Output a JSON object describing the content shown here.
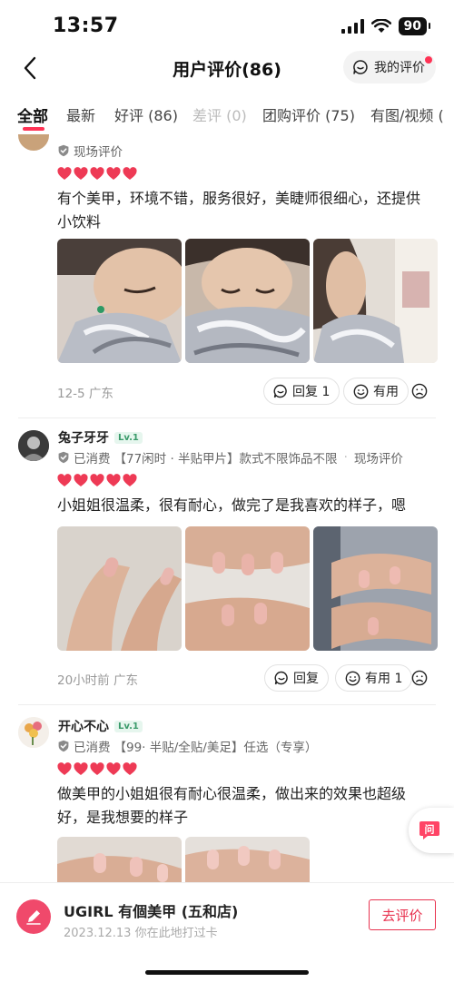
{
  "status": {
    "time": "13:57",
    "battery": "90"
  },
  "nav": {
    "title": "用户评价(86)",
    "my_review_label": "我的评价"
  },
  "tabs": [
    {
      "label": "全部"
    },
    {
      "label": "最新"
    },
    {
      "label": "好评 (86)"
    },
    {
      "label": "差评 (0)"
    },
    {
      "label": "团购评价 (75)"
    },
    {
      "label": "有图/视频 ("
    }
  ],
  "reviews": [
    {
      "meta": "现场评价",
      "rating_hearts": 5,
      "text": "有个美甲，环境不错，服务很好，美睫师很细心，还提供小饮料",
      "date_location": "12-5  广东",
      "reply_label": "回复 1",
      "useful_label": "有用"
    },
    {
      "username": "兔子牙牙",
      "level": "Lv.1",
      "consumed": "已消费",
      "deal": "【77闲时 · 半贴甲片】款式不限饰品不限",
      "tag": "现场评价",
      "rating_hearts": 5,
      "text": "小姐姐很温柔，很有耐心，做完了是我喜欢的样子，嗯",
      "date_location": "20小时前  广东",
      "reply_label": "回复",
      "useful_label": "有用 1"
    },
    {
      "username": "开心不心",
      "level": "Lv.1",
      "consumed": "已消费",
      "deal": "【99· 半贴/全贴/美足】任选（专享）",
      "rating_hearts": 5,
      "text": "做美甲的小姐姐很有耐心很温柔，做出来的效果也超级好，是我想要的样子"
    }
  ],
  "float_button": {
    "label": "问"
  },
  "bottom": {
    "shop_name": "UGIRL 有個美甲 (五和店)",
    "checkin": "2023.12.13 你在此地打过卡",
    "action_label": "去评价"
  },
  "colors": {
    "accent": "#ff3355",
    "heart": "#ee3a55",
    "button_red": "#e8324f"
  }
}
